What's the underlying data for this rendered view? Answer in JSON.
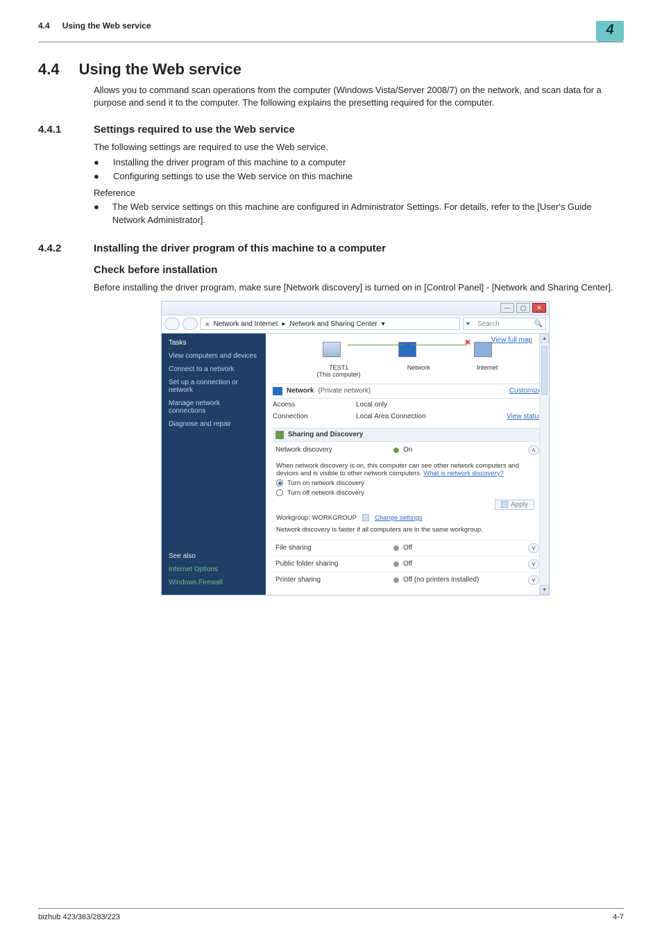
{
  "header": {
    "section_ref": "4.4",
    "section_ref_title": "Using the Web service",
    "chapter_tab": "4"
  },
  "s44": {
    "num": "4.4",
    "title": "Using the Web service",
    "para": "Allows you to command scan operations from the computer (Windows Vista/Server 2008/7) on the network, and scan data for a purpose and send it to the computer. The following explains the presetting required for the computer."
  },
  "s441": {
    "num": "4.4.1",
    "title": "Settings required to use the Web service",
    "intro": "The following settings are required to use the Web service.",
    "bullets": [
      "Installing the driver program of this machine to a computer",
      "Configuring settings to use the Web service on this machine"
    ],
    "ref_label": "Reference",
    "ref_bullet": "The Web service settings on this machine are configured in Administrator Settings. For details, refer to the [User's Guide Network Administrator]."
  },
  "s442": {
    "num": "4.4.2",
    "title": "Installing the driver program of this machine to a computer",
    "check_title": "Check before installation",
    "check_para": "Before installing the driver program, make sure [Network discovery] is turned on in [Control Panel] - [Network and Sharing Center]."
  },
  "screenshot": {
    "breadcrumb": {
      "prefix": "«",
      "a": "Network and Internet",
      "b": "Network and Sharing Center"
    },
    "search_placeholder": "Search",
    "view_full_map": "View full map",
    "nodes": {
      "pc": "TEST1",
      "pc_sub": "(This computer)",
      "net": "Network",
      "int": "Internet"
    },
    "group": {
      "title": "Network",
      "sub": "(Private network)",
      "customize": "Customize"
    },
    "rows": {
      "access_k": "Access",
      "access_v": "Local only",
      "conn_k": "Connection",
      "conn_v": "Local Area Connection",
      "conn_link": "View status"
    },
    "sharing_header": "Sharing and Discovery",
    "net_disc": {
      "label": "Network discovery",
      "value": "On"
    },
    "disc_explain_a": "When network discovery is on, this computer can see other network computers and devices and is visible to other network computers. ",
    "disc_explain_link": "What is network discovery?",
    "radio_on": "Turn on network discovery",
    "radio_off": "Turn off network discovery",
    "apply": "Apply",
    "workgroup_label": "Workgroup: WORKGROUP",
    "change_settings": "Change settings",
    "note": "Network discovery is faster if all computers are in the same workgroup.",
    "file_sharing": {
      "label": "File sharing",
      "value": "Off"
    },
    "public_folder": {
      "label": "Public folder sharing",
      "value": "Off"
    },
    "printer_sharing": {
      "label": "Printer sharing",
      "value": "Off (no printers installed)"
    },
    "tasks": {
      "heading": "Tasks",
      "items": [
        "View computers and devices",
        "Connect to a network",
        "Set up a connection or network",
        "Manage network connections",
        "Diagnose and repair"
      ],
      "see_also": "See also",
      "also_items": [
        "Internet Options",
        "Windows Firewall"
      ]
    }
  },
  "footer": {
    "left": "bizhub 423/363/283/223",
    "right": "4-7"
  }
}
